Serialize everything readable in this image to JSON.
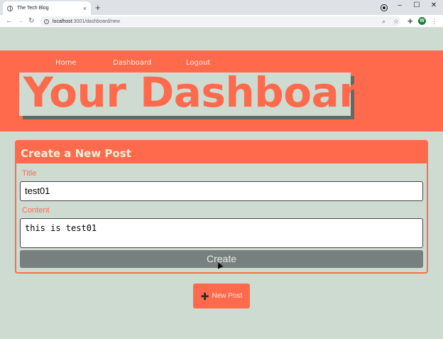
{
  "browser": {
    "tab_title": "The Tech Blog",
    "tab_close": "×",
    "new_tab": "+",
    "url_host": "localhost",
    "url_path": ":3001/dashboard/new",
    "profile_initial": "W",
    "window_controls": [
      "–",
      "☐",
      "✕"
    ]
  },
  "nav": {
    "home": "Home",
    "dashboard": "Dashboard",
    "logout": "Logout"
  },
  "page": {
    "heading": "Your Dashboard"
  },
  "form": {
    "title": "Create a New Post",
    "title_label": "Title",
    "title_value": "test01",
    "content_label": "Content",
    "content_value": "this is test01",
    "submit_label": "Create"
  },
  "new_post_button": {
    "label": "New Post"
  },
  "colors": {
    "accent": "#ff6a4d",
    "background": "#cddbd1",
    "button_gray": "#77807e"
  }
}
